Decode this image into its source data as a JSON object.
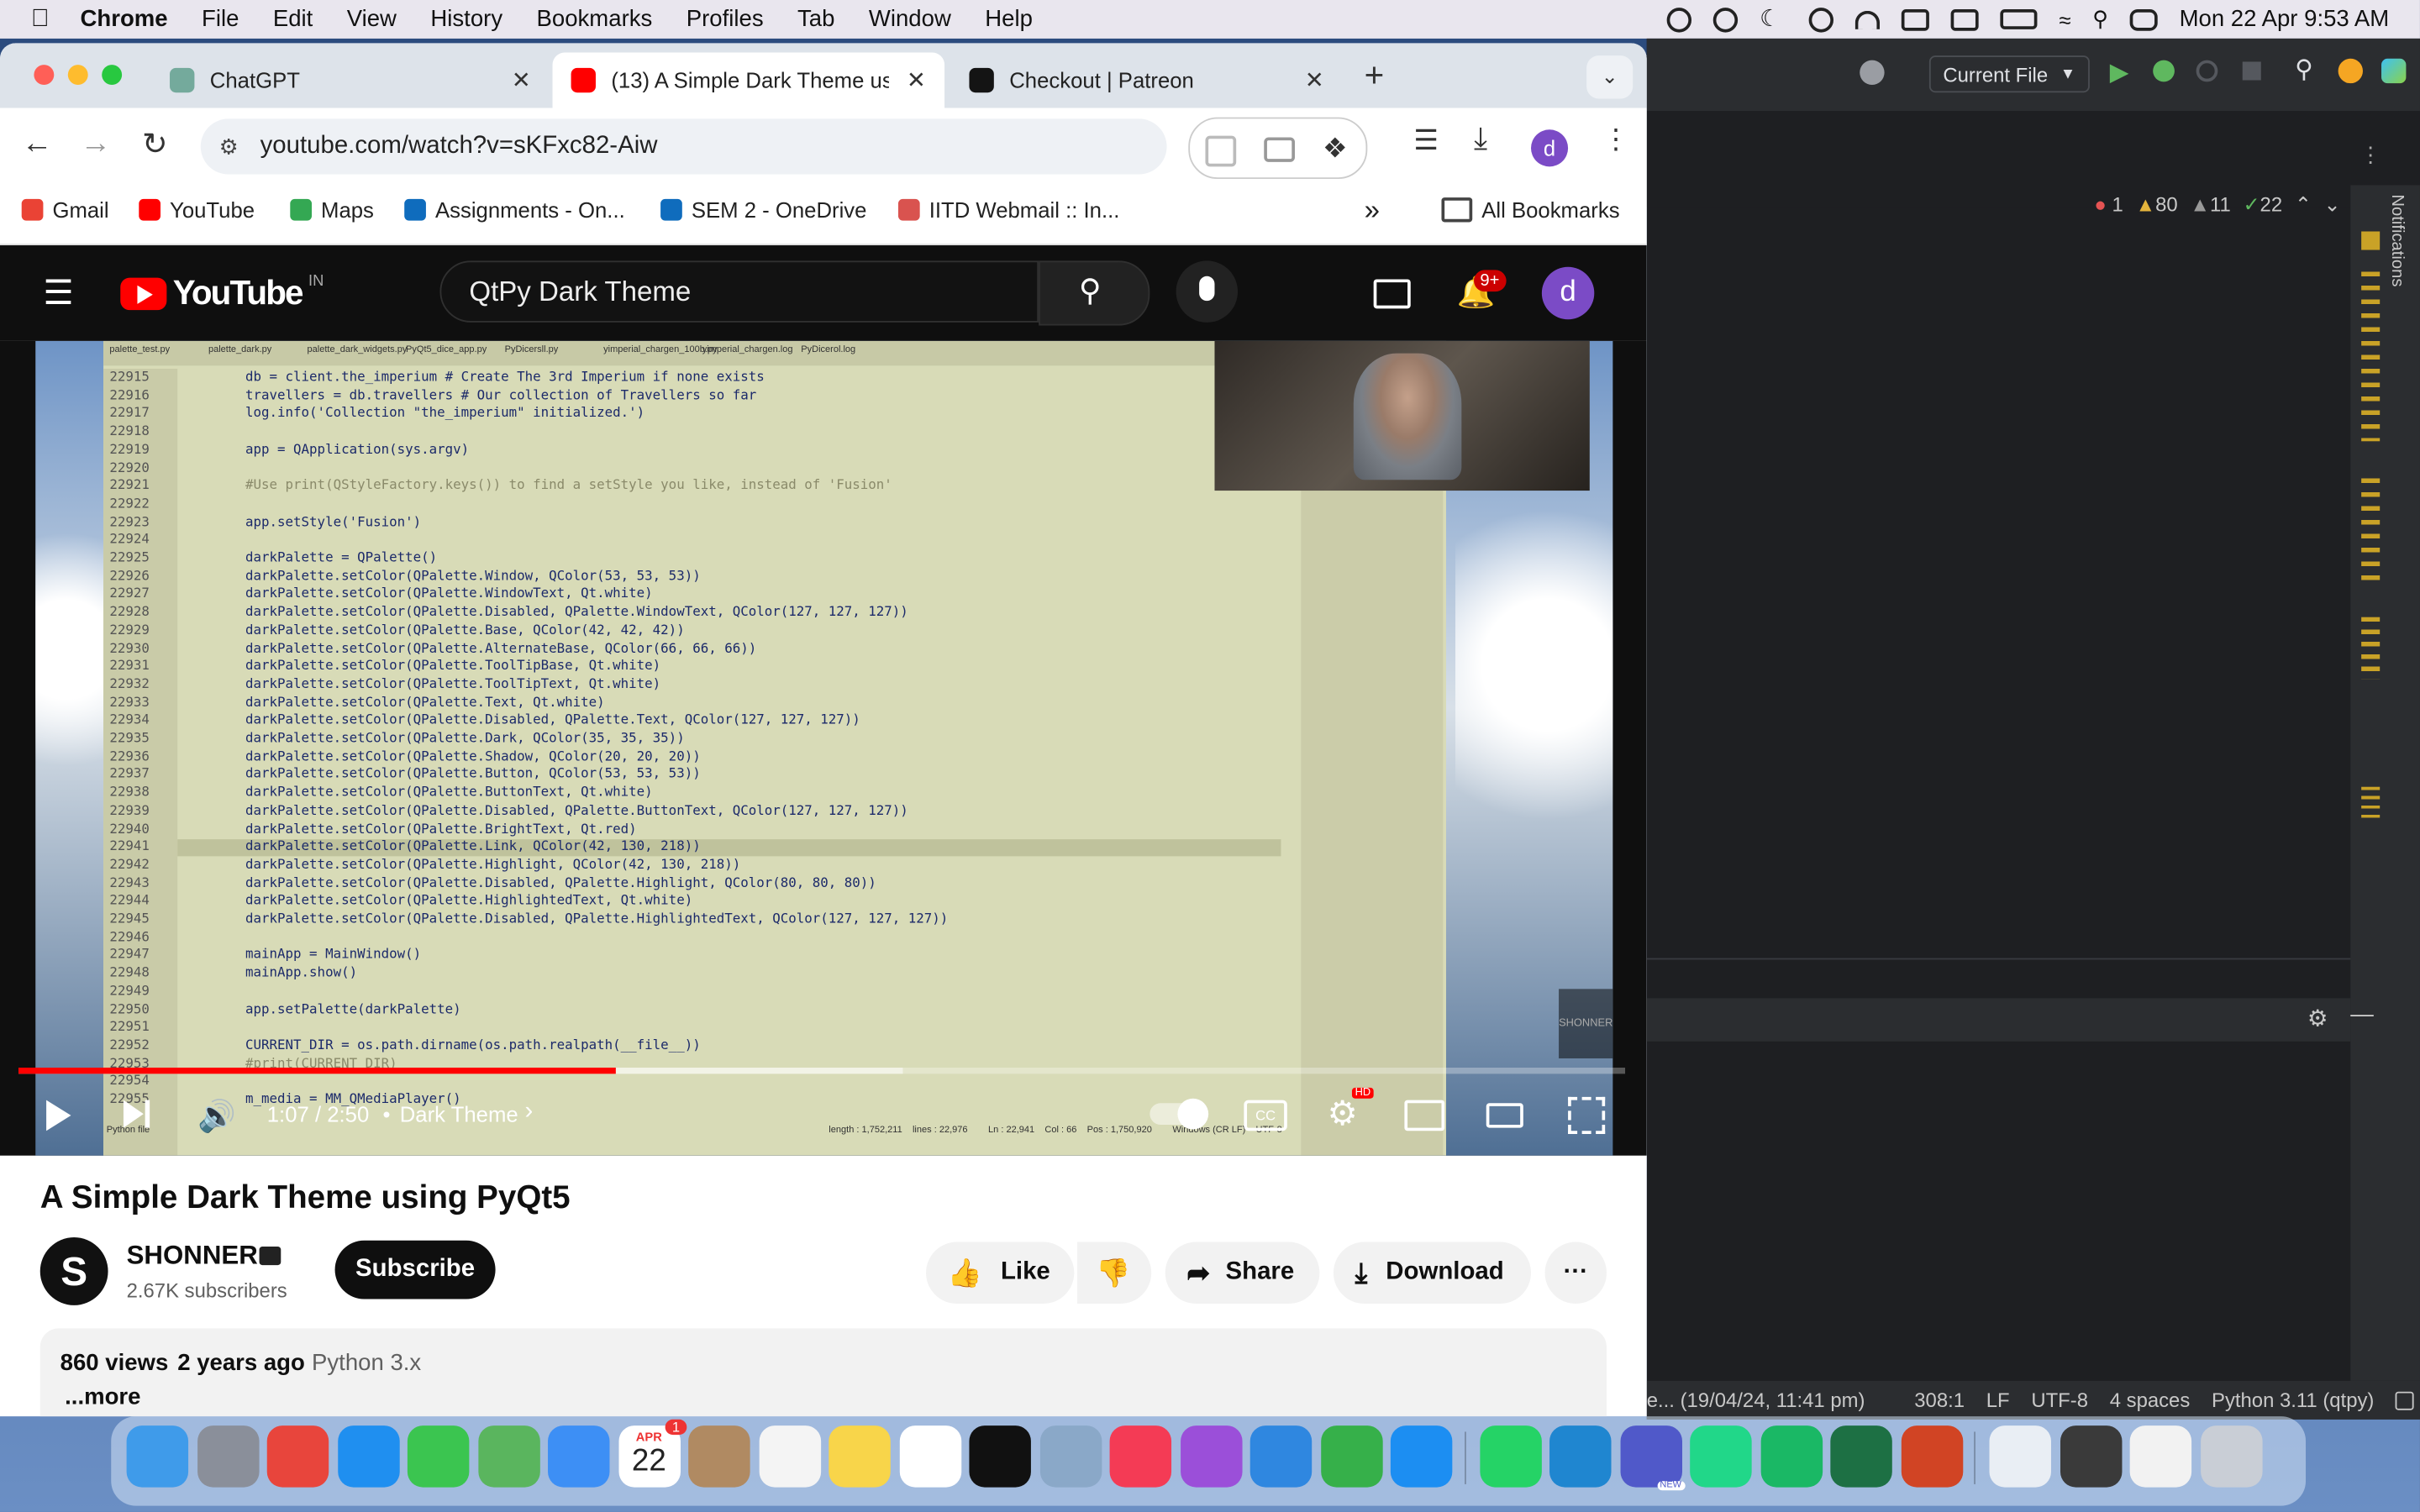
{
  "menubar": {
    "app_name": "Chrome",
    "items": [
      "File",
      "Edit",
      "View",
      "History",
      "Bookmarks",
      "Profiles",
      "Tab",
      "Window",
      "Help"
    ],
    "clock": "Mon 22 Apr  9:53 AM"
  },
  "browser": {
    "tabs": [
      {
        "label": "ChatGPT",
        "color": "#74aa9c"
      },
      {
        "label": "(13) A Simple Dark Theme us",
        "color": "#ff0000"
      },
      {
        "label": "Checkout | Patreon",
        "color": "#141414"
      }
    ],
    "new_tab_glyph": "+",
    "url": "youtube.com/watch?v=sKFxc82-Aiw",
    "profile_letter": "d",
    "bookmarks": [
      {
        "label": "Gmail",
        "color": "#ea4335"
      },
      {
        "label": "YouTube",
        "color": "#ff0000"
      },
      {
        "label": "Maps",
        "color": "#34a853"
      },
      {
        "label": "Assignments - On...",
        "color": "#0f6cbd"
      },
      {
        "label": "SEM 2 - OneDrive",
        "color": "#0f6cbd"
      },
      {
        "label": "IITD Webmail :: In...",
        "color": "#d9534f"
      }
    ],
    "more_bookmarks": "»",
    "all_bookmarks": "All Bookmarks"
  },
  "youtube": {
    "logo_text": "YouTube",
    "region": "IN",
    "search_value": "QtPy Dark Theme",
    "notifications_badge": "9+",
    "avatar_letter": "d",
    "player": {
      "time": "1:07 / 2:50",
      "chapter": "Dark Theme",
      "progress_fraction": 0.372,
      "buffered_fraction": 0.55,
      "hd_badge": "HD",
      "cc_label": "CC",
      "watermark": "SHONNER"
    },
    "video_title": "A Simple Dark Theme using PyQt5",
    "channel": {
      "name": "SHONNER",
      "subscribers": "2.67K subscribers",
      "logo_letter": "S"
    },
    "actions": {
      "subscribe": "Subscribe",
      "like": "Like",
      "share": "Share",
      "download": "Download",
      "more": "···"
    },
    "description": {
      "views": "860 views",
      "age": "2 years ago",
      "tag": "Python 3.x",
      "more": "...more"
    }
  },
  "video_code": {
    "editor_tabs": [
      "palette_test.py",
      "palette_dark.py",
      "palette_dark_widgets.py",
      "PyQt5_dice_app.py",
      "PyDicersll.py",
      "yimperial_chargen_100b.py",
      "yimperial_chargen.log",
      "PyDicerol.log"
    ],
    "lines": [
      {
        "n": "22915",
        "t": "db = client.the_imperium # Create The 3rd Imperium if none exists"
      },
      {
        "n": "22916",
        "t": "travellers = db.travellers # Our collection of Travellers so far"
      },
      {
        "n": "22917",
        "t": "log.info('Collection \"the_imperium\" initialized.')"
      },
      {
        "n": "22918",
        "t": ""
      },
      {
        "n": "22919",
        "t": "app = QApplication(sys.argv)"
      },
      {
        "n": "22920",
        "t": ""
      },
      {
        "n": "22921",
        "t": "#Use print(QStyleFactory.keys()) to find a setStyle you like, instead of 'Fusion'"
      },
      {
        "n": "22922",
        "t": ""
      },
      {
        "n": "22923",
        "t": "app.setStyle('Fusion')"
      },
      {
        "n": "22924",
        "t": ""
      },
      {
        "n": "22925",
        "t": "darkPalette = QPalette()"
      },
      {
        "n": "22926",
        "t": "darkPalette.setColor(QPalette.Window, QColor(53, 53, 53))"
      },
      {
        "n": "22927",
        "t": "darkPalette.setColor(QPalette.WindowText, Qt.white)"
      },
      {
        "n": "22928",
        "t": "darkPalette.setColor(QPalette.Disabled, QPalette.WindowText, QColor(127, 127, 127))"
      },
      {
        "n": "22929",
        "t": "darkPalette.setColor(QPalette.Base, QColor(42, 42, 42))"
      },
      {
        "n": "22930",
        "t": "darkPalette.setColor(QPalette.AlternateBase, QColor(66, 66, 66))"
      },
      {
        "n": "22931",
        "t": "darkPalette.setColor(QPalette.ToolTipBase, Qt.white)"
      },
      {
        "n": "22932",
        "t": "darkPalette.setColor(QPalette.ToolTipText, Qt.white)"
      },
      {
        "n": "22933",
        "t": "darkPalette.setColor(QPalette.Text, Qt.white)"
      },
      {
        "n": "22934",
        "t": "darkPalette.setColor(QPalette.Disabled, QPalette.Text, QColor(127, 127, 127))"
      },
      {
        "n": "22935",
        "t": "darkPalette.setColor(QPalette.Dark, QColor(35, 35, 35))"
      },
      {
        "n": "22936",
        "t": "darkPalette.setColor(QPalette.Shadow, QColor(20, 20, 20))"
      },
      {
        "n": "22937",
        "t": "darkPalette.setColor(QPalette.Button, QColor(53, 53, 53))"
      },
      {
        "n": "22938",
        "t": "darkPalette.setColor(QPalette.ButtonText, Qt.white)"
      },
      {
        "n": "22939",
        "t": "darkPalette.setColor(QPalette.Disabled, QPalette.ButtonText, QColor(127, 127, 127))"
      },
      {
        "n": "22940",
        "t": "darkPalette.setColor(QPalette.BrightText, Qt.red)"
      },
      {
        "n": "22941",
        "t": "darkPalette.setColor(QPalette.Link, QColor(42, 130, 218))"
      },
      {
        "n": "22942",
        "t": "darkPalette.setColor(QPalette.Highlight, QColor(42, 130, 218))"
      },
      {
        "n": "22943",
        "t": "darkPalette.setColor(QPalette.Disabled, QPalette.Highlight, QColor(80, 80, 80))"
      },
      {
        "n": "22944",
        "t": "darkPalette.setColor(QPalette.HighlightedText, Qt.white)"
      },
      {
        "n": "22945",
        "t": "darkPalette.setColor(QPalette.Disabled, QPalette.HighlightedText, QColor(127, 127, 127))"
      },
      {
        "n": "22946",
        "t": ""
      },
      {
        "n": "22947",
        "t": "mainApp = MainWindow()"
      },
      {
        "n": "22948",
        "t": "mainApp.show()"
      },
      {
        "n": "22949",
        "t": ""
      },
      {
        "n": "22950",
        "t": "app.setPalette(darkPalette)"
      },
      {
        "n": "22951",
        "t": ""
      },
      {
        "n": "22952",
        "t": "CURRENT_DIR = os.path.dirname(os.path.realpath(__file__))"
      },
      {
        "n": "22953",
        "t": "#print(CURRENT_DIR)"
      },
      {
        "n": "22954",
        "t": ""
      },
      {
        "n": "22955",
        "t": "m_media = MM_QMediaPlayer()"
      }
    ],
    "statusbar": "length : 1,752,211    lines : 22,976        Ln : 22,941    Col : 66    Pos : 1,750,920        Windows (CR LF)    UTF-8",
    "footer_left": "Python file"
  },
  "ide": {
    "run_config": "Current File",
    "inspections": {
      "errors": "1",
      "warnings": "80",
      "weak": "11",
      "ok": "22"
    },
    "notifications_label": "Notifications",
    "status": {
      "left": "e... (19/04/24, 11:41 pm)",
      "position": "308:1",
      "line_sep": "LF",
      "encoding": "UTF-8",
      "indent": "4 spaces",
      "interpreter": "Python 3.11 (qtpy)"
    }
  },
  "dock": {
    "calendar_month": "APR",
    "calendar_day": "22",
    "calendar_badge": "1",
    "apps": [
      {
        "name": "finder",
        "color": "#3f9bea"
      },
      {
        "name": "launchpad",
        "color": "#8a8f9a"
      },
      {
        "name": "chrome",
        "color": "#e8453c"
      },
      {
        "name": "safari",
        "color": "#1f8ff0"
      },
      {
        "name": "facetime",
        "color": "#3bc550"
      },
      {
        "name": "maps",
        "color": "#5ab55e"
      },
      {
        "name": "mail",
        "color": "#3d8ff5"
      },
      {
        "name": "calendar",
        "color": "#ffffff"
      },
      {
        "name": "contacts",
        "color": "#b08a62"
      },
      {
        "name": "reminders",
        "color": "#f4f4f4"
      },
      {
        "name": "notes",
        "color": "#f8d54a"
      },
      {
        "name": "freeform",
        "color": "#ffffff"
      },
      {
        "name": "tv",
        "color": "#111111"
      },
      {
        "name": "preview",
        "color": "#8aa8c8"
      },
      {
        "name": "music",
        "color": "#f43b55"
      },
      {
        "name": "podcasts",
        "color": "#9b4fd9"
      },
      {
        "name": "keynote",
        "color": "#2f87e0"
      },
      {
        "name": "numbers",
        "color": "#36b04a"
      },
      {
        "name": "appstore",
        "color": "#1c8ef2"
      },
      {
        "name": "whatsapp",
        "color": "#25d366"
      },
      {
        "name": "vscode",
        "color": "#1f86d0"
      },
      {
        "name": "teams",
        "color": "#5059c9"
      },
      {
        "name": "pycharm",
        "color": "#21d789"
      },
      {
        "name": "dataspell",
        "color": "#1ab865"
      },
      {
        "name": "excel",
        "color": "#1d7044"
      },
      {
        "name": "powerpoint",
        "color": "#d14424"
      },
      {
        "name": "window-1",
        "color": "#e9eef4"
      },
      {
        "name": "window-2",
        "color": "#3a3a3a"
      },
      {
        "name": "window-3",
        "color": "#f2f2f2"
      },
      {
        "name": "trash",
        "color": "#c9ced6"
      }
    ],
    "teams_badge": "NEW"
  }
}
